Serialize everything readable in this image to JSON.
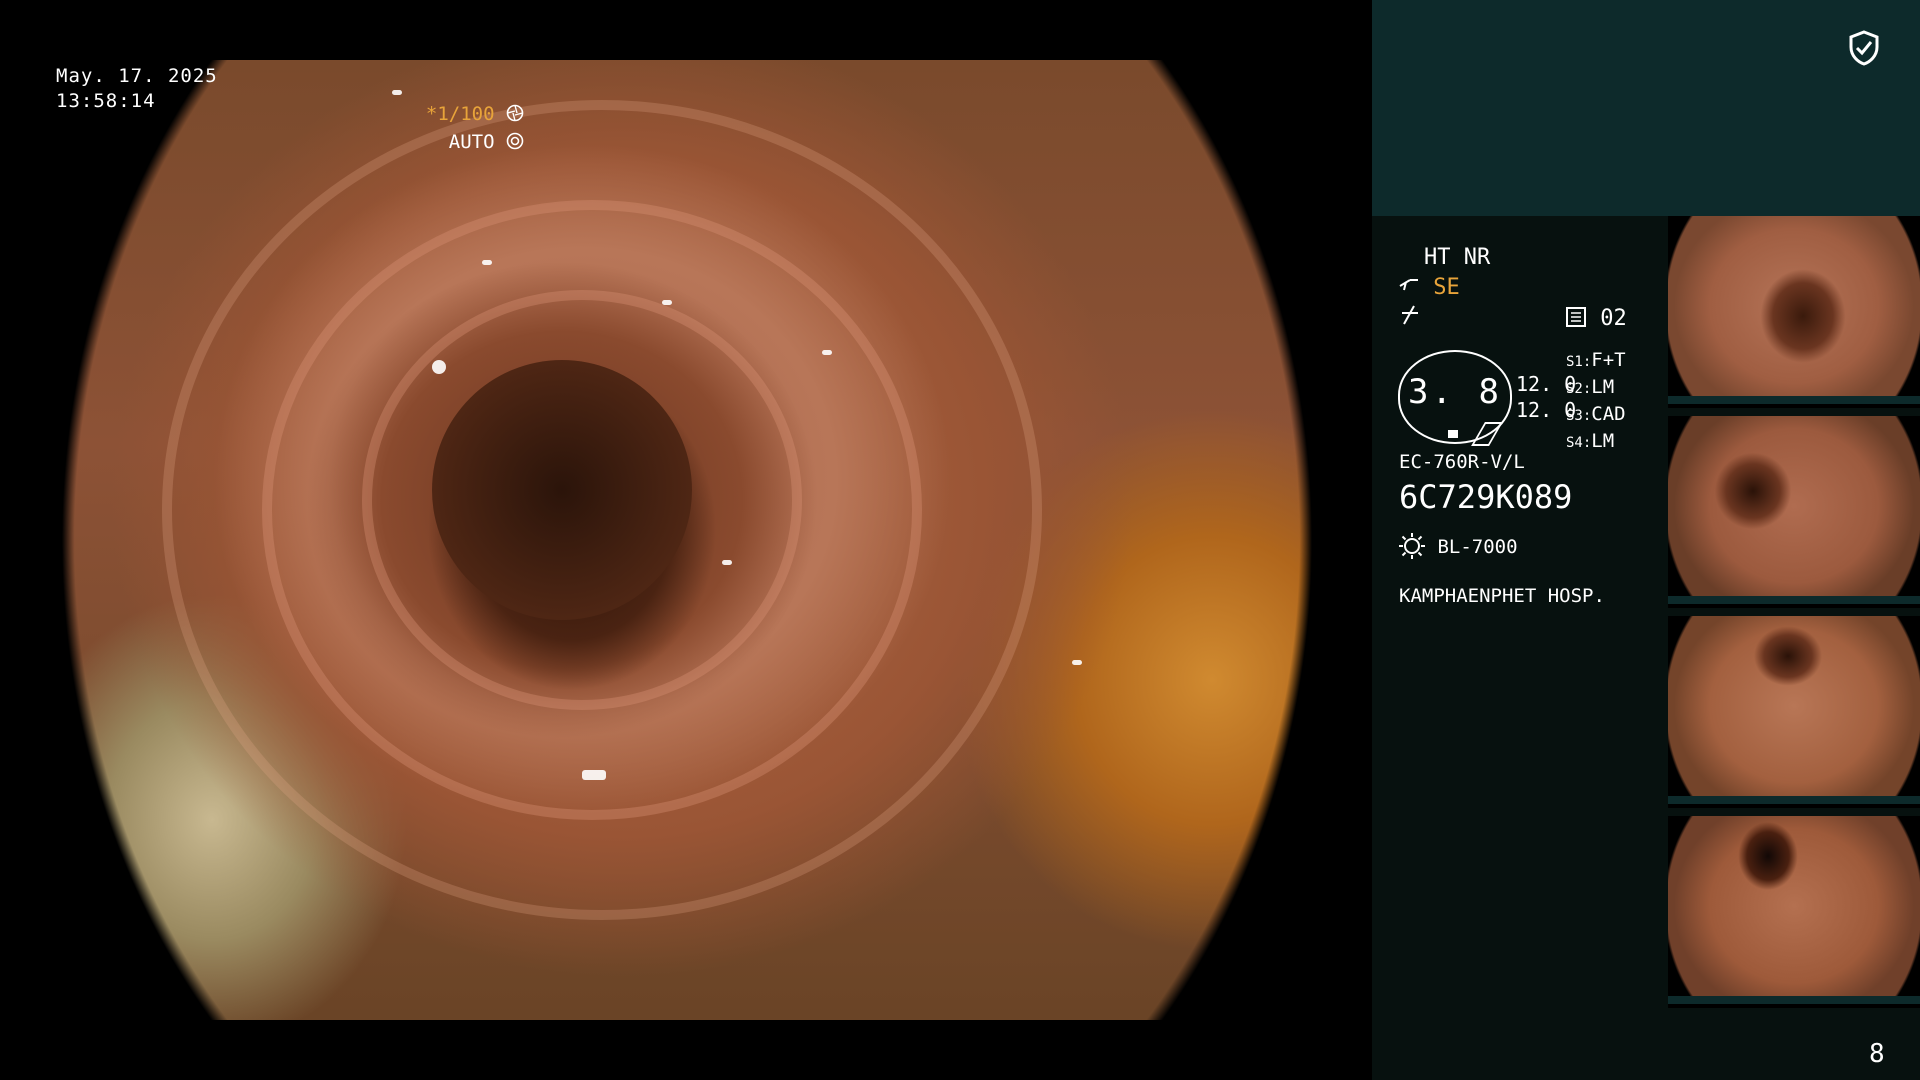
{
  "overlay": {
    "date": "May. 17. 2025",
    "time": "13:58:14",
    "shutter_speed": "*1/100",
    "exposure_mode": "AUTO"
  },
  "panel": {
    "enhancement": "HT NR",
    "structure_mode": "SE",
    "preset_number": "02",
    "gauge_value": "3. 8",
    "level_1": "12. 0",
    "level_2": "12. 0",
    "settings": [
      {
        "key": "S1:",
        "value": "F+T"
      },
      {
        "key": "S2:",
        "value": "LM"
      },
      {
        "key": "S3:",
        "value": "CAD"
      },
      {
        "key": "S4:",
        "value": "LM"
      }
    ],
    "scope_model": "EC-760R-V/L",
    "serial_number": "6C729K089",
    "light_source": "BL-7000",
    "hospital": "KAMPHAENPHET HOSP.",
    "frame_count": "8"
  },
  "colors": {
    "accent_orange": "#e8a43a",
    "panel_top": "#0d2a2b",
    "panel_bg": "#07110f"
  },
  "icons": [
    "shield-check-icon",
    "scope-angle-icon",
    "freeze-icon",
    "memory-card-icon",
    "aperture-icon",
    "light-source-icon"
  ]
}
